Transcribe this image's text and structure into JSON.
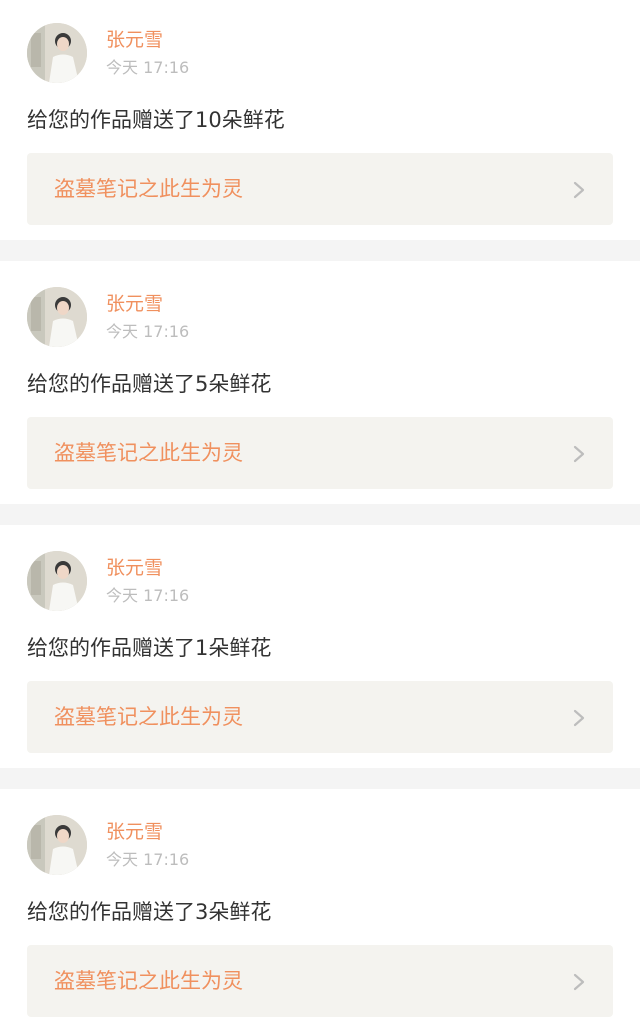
{
  "notifications": [
    {
      "user_name": "张元雪",
      "timestamp": "今天 17:16",
      "message": "给您的作品赠送了10朵鲜花",
      "work_title": "盗墓笔记之此生为灵",
      "avatar_icon": "user-avatar-icon",
      "chevron_icon": "chevron-right-icon"
    },
    {
      "user_name": "张元雪",
      "timestamp": "今天 17:16",
      "message": "给您的作品赠送了5朵鲜花",
      "work_title": "盗墓笔记之此生为灵",
      "avatar_icon": "user-avatar-icon",
      "chevron_icon": "chevron-right-icon"
    },
    {
      "user_name": "张元雪",
      "timestamp": "今天 17:16",
      "message": "给您的作品赠送了1朵鲜花",
      "work_title": "盗墓笔记之此生为灵",
      "avatar_icon": "user-avatar-icon",
      "chevron_icon": "chevron-right-icon"
    },
    {
      "user_name": "张元雪",
      "timestamp": "今天 17:16",
      "message": "给您的作品赠送了3朵鲜花",
      "work_title": "盗墓笔记之此生为灵",
      "avatar_icon": "user-avatar-icon",
      "chevron_icon": "chevron-right-icon"
    }
  ],
  "colors": {
    "page_background": "#f4f4f4",
    "card_background": "#ffffff",
    "user_name": "#f0905e",
    "timestamp": "#bdbdbd",
    "message": "#333333",
    "link_background": "#f4f3ef",
    "link_text": "#f0905e",
    "chevron": "#bdbdbd"
  }
}
